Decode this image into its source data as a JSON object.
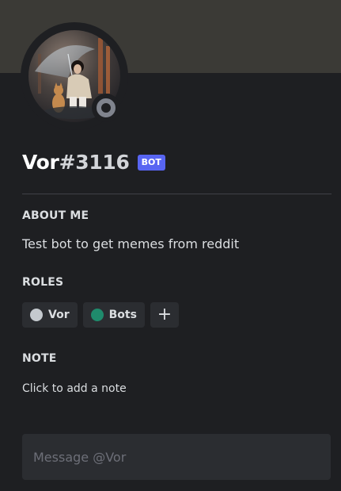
{
  "profile": {
    "username": "Vor",
    "discriminator": "#3116",
    "bot_tag": "BOT",
    "status": "offline"
  },
  "about": {
    "title": "ABOUT ME",
    "text": "Test bot to get memes from reddit"
  },
  "roles": {
    "title": "ROLES",
    "items": [
      {
        "label": "Vor",
        "color": "#c4c9ce"
      },
      {
        "label": "Bots",
        "color": "#1f8b6c"
      }
    ],
    "add_label": "+"
  },
  "note": {
    "title": "NOTE",
    "placeholder": "Click to add a note"
  },
  "message": {
    "placeholder": "Message @Vor"
  },
  "colors": {
    "banner": "#3b3a36",
    "card_bg": "#1e1f22",
    "bot_tag": "#5865f2",
    "status_offline": "#80848e"
  }
}
